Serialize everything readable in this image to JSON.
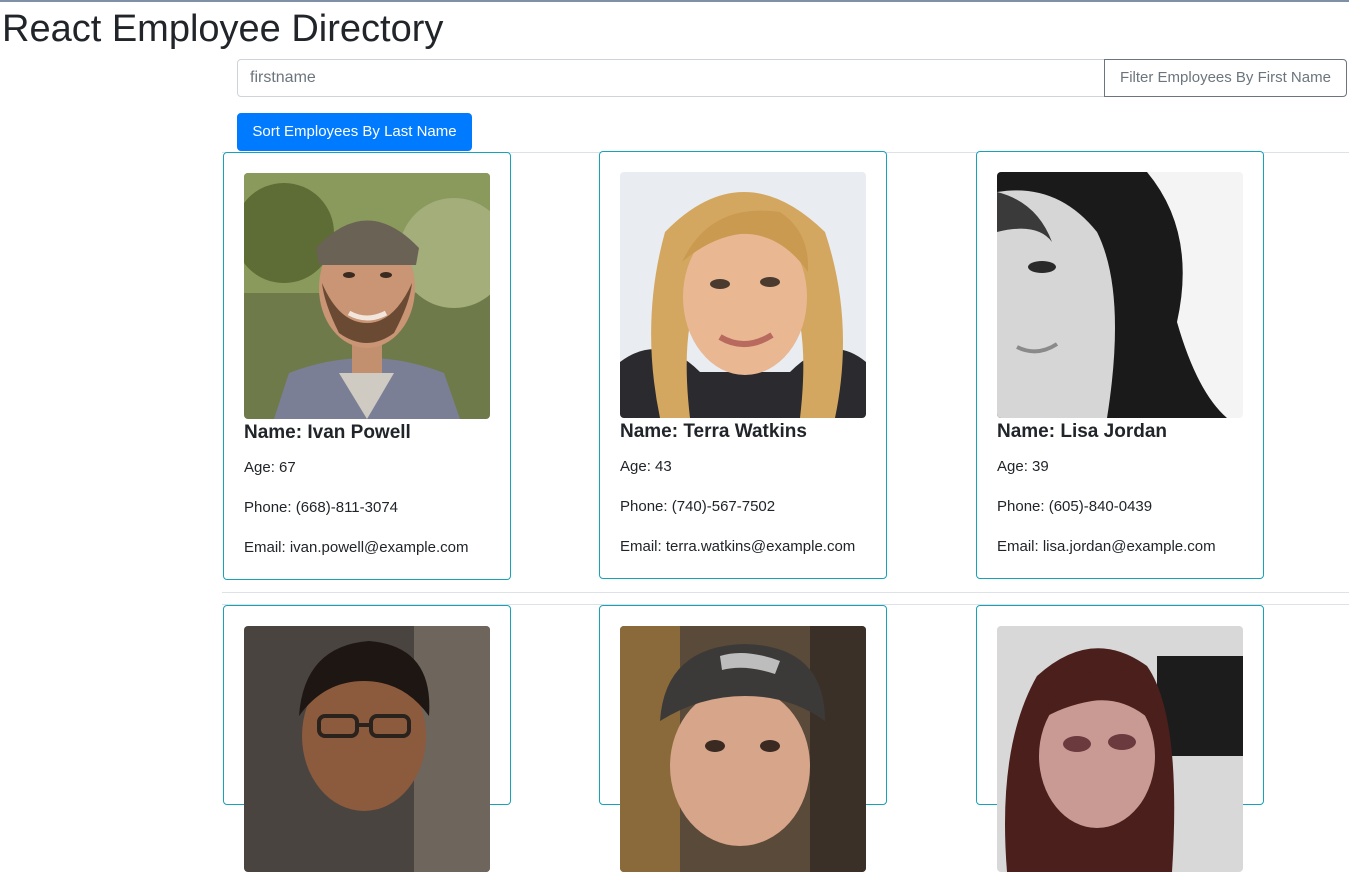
{
  "app": {
    "title": "React Employee Directory"
  },
  "search": {
    "value": "",
    "placeholder": "firstname",
    "filter_button_label": "Filter Employees By First Name"
  },
  "sort_button_label": "Sort Employees By Last Name",
  "employees": [
    {
      "photo": "employee-photo",
      "name": "Name: Ivan Powell",
      "age": "Age: 67",
      "phone": "Phone: (668)-811-3074",
      "email": "Email: ivan.powell@example.com"
    },
    {
      "photo": "employee-photo",
      "name": "Name: Terra Watkins",
      "age": "Age: 43",
      "phone": "Phone: (740)-567-7502",
      "email": "Email: terra.watkins@example.com"
    },
    {
      "photo": "employee-photo",
      "name": "Name: Lisa Jordan",
      "age": "Age: 39",
      "phone": "Phone: (605)-840-0439",
      "email": "Email: lisa.jordan@example.com"
    },
    {
      "photo": "employee-photo"
    },
    {
      "photo": "employee-photo"
    },
    {
      "photo": "employee-photo"
    }
  ],
  "colors": {
    "card_border": "#17a2b8",
    "primary": "#007bff",
    "secondary": "#6c757d"
  }
}
